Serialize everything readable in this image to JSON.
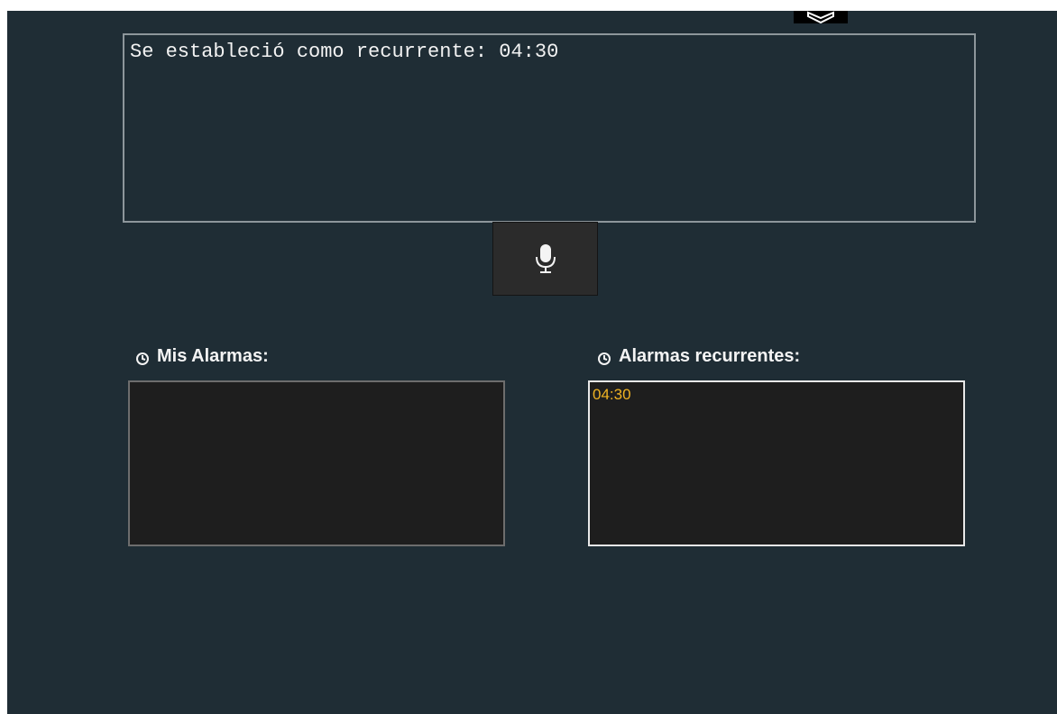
{
  "output": {
    "text": "Se estableció como recurrente: 04:30"
  },
  "mic_button": {
    "icon": "microphone-icon"
  },
  "my_alarms": {
    "label": "Mis Alarmas:",
    "icon": "clock-icon",
    "items": []
  },
  "recurring_alarms": {
    "label": "Alarmas recurrentes:",
    "icon": "clock-icon",
    "items": [
      "04:30"
    ]
  },
  "colors": {
    "background": "#1f2d35",
    "list_bg": "#1e1e1e",
    "item_text": "#f0b323",
    "button_bg": "#2b2b2b"
  }
}
